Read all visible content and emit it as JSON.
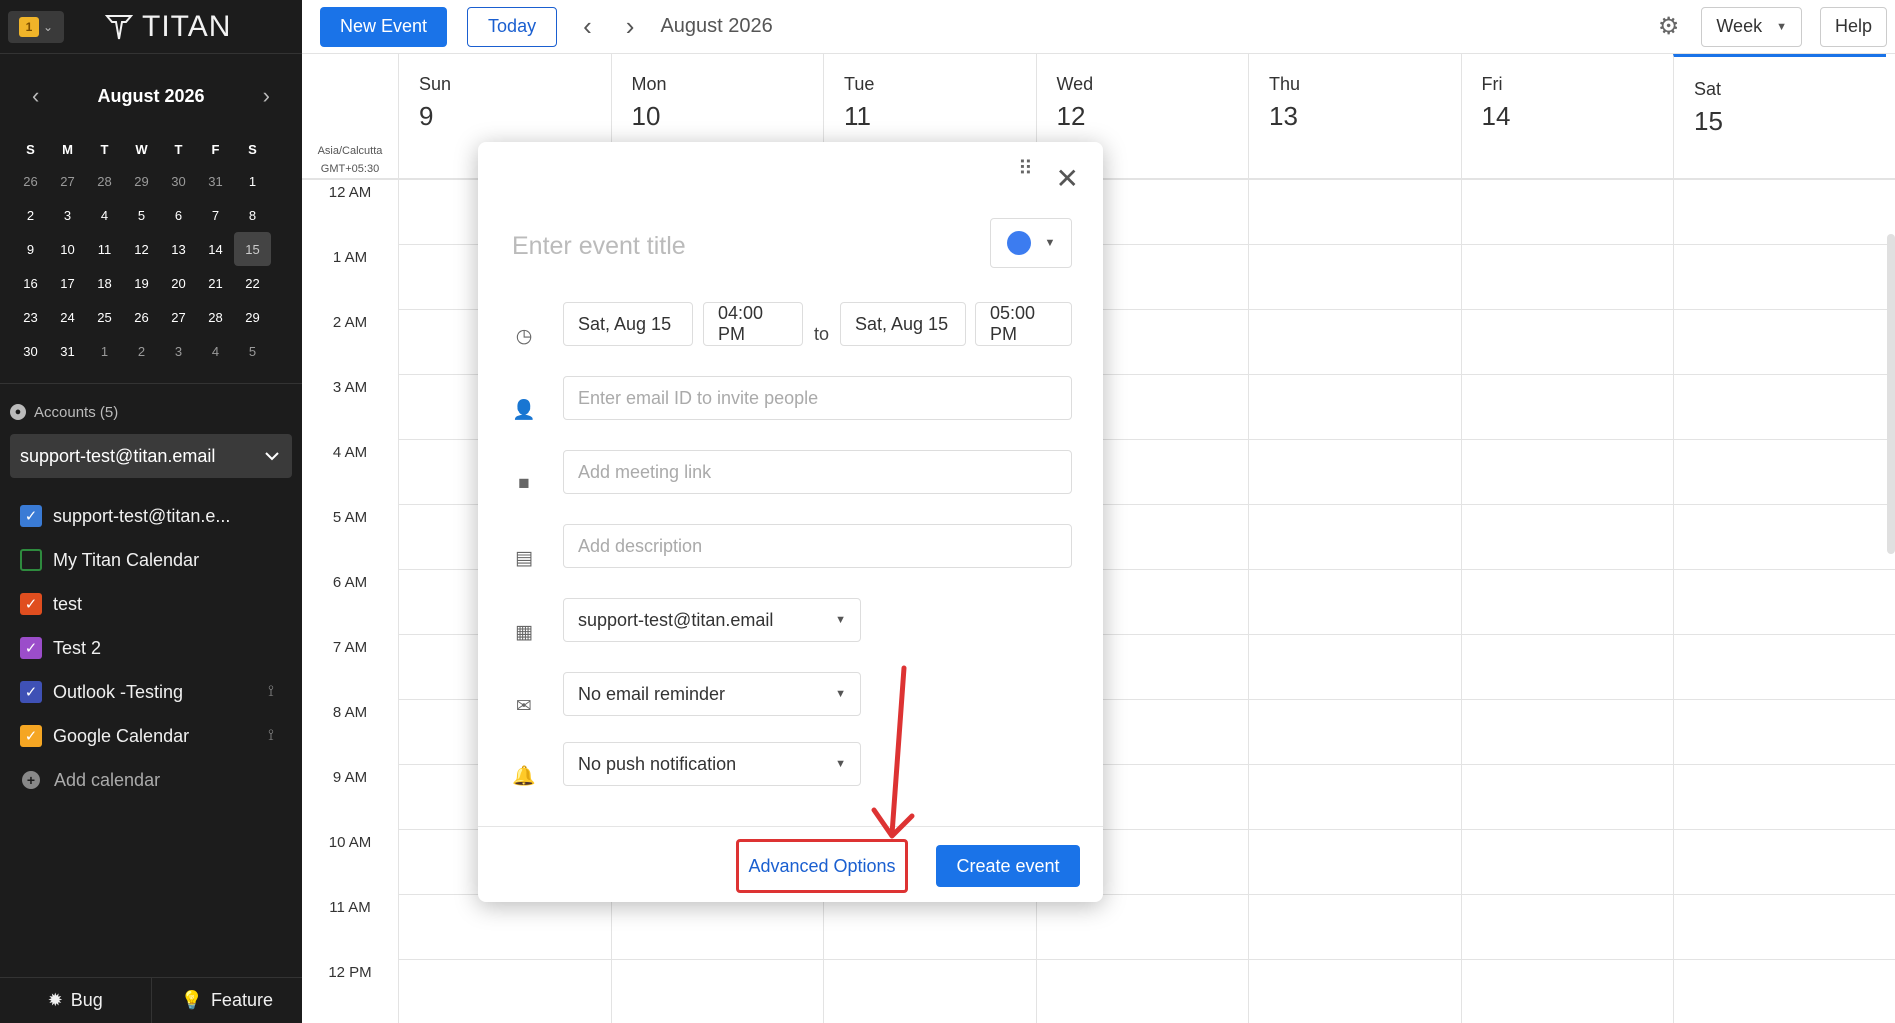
{
  "sidebar": {
    "app_badge": "1",
    "logo": "TITAN",
    "mini_cal": {
      "title": "August 2026",
      "dows": [
        "S",
        "M",
        "T",
        "W",
        "T",
        "F",
        "S"
      ],
      "days": [
        {
          "n": "26",
          "other": true
        },
        {
          "n": "27",
          "other": true
        },
        {
          "n": "28",
          "other": true
        },
        {
          "n": "29",
          "other": true
        },
        {
          "n": "30",
          "other": true
        },
        {
          "n": "31",
          "other": true
        },
        {
          "n": "1"
        },
        {
          "n": "2"
        },
        {
          "n": "3"
        },
        {
          "n": "4"
        },
        {
          "n": "5"
        },
        {
          "n": "6"
        },
        {
          "n": "7"
        },
        {
          "n": "8"
        },
        {
          "n": "9"
        },
        {
          "n": "10"
        },
        {
          "n": "11"
        },
        {
          "n": "12"
        },
        {
          "n": "13"
        },
        {
          "n": "14"
        },
        {
          "n": "15",
          "sel": true
        },
        {
          "n": "16"
        },
        {
          "n": "17"
        },
        {
          "n": "18"
        },
        {
          "n": "19"
        },
        {
          "n": "20"
        },
        {
          "n": "21"
        },
        {
          "n": "22"
        },
        {
          "n": "23"
        },
        {
          "n": "24"
        },
        {
          "n": "25"
        },
        {
          "n": "26"
        },
        {
          "n": "27"
        },
        {
          "n": "28"
        },
        {
          "n": "29"
        },
        {
          "n": "30"
        },
        {
          "n": "31"
        },
        {
          "n": "1",
          "other": true
        },
        {
          "n": "2",
          "other": true
        },
        {
          "n": "3",
          "other": true
        },
        {
          "n": "4",
          "other": true
        },
        {
          "n": "5",
          "other": true
        }
      ]
    },
    "accounts_label": "Accounts (5)",
    "account_selected": "support-test@titan.email",
    "calendars": [
      {
        "label": "support-test@titan.e...",
        "checked": true,
        "color": "#3a7bd5",
        "feed": false
      },
      {
        "label": "My Titan Calendar",
        "checked": false,
        "color": "#2e8b3e",
        "feed": false
      },
      {
        "label": "test",
        "checked": true,
        "color": "#e04e1f",
        "feed": false
      },
      {
        "label": "Test 2",
        "checked": true,
        "color": "#9b4dca",
        "feed": false
      },
      {
        "label": "Outlook -Testing",
        "checked": true,
        "color": "#3f51b5",
        "feed": true
      },
      {
        "label": "Google Calendar",
        "checked": true,
        "color": "#f5a623",
        "feed": true
      }
    ],
    "add_calendar": "Add calendar",
    "footer": {
      "bug": "Bug",
      "feature": "Feature"
    }
  },
  "topbar": {
    "new_event": "New Event",
    "today": "Today",
    "title": "August 2026",
    "view": "Week",
    "help": "Help"
  },
  "week": {
    "tz_line1": "Asia/Calcutta",
    "tz_line2": "GMT+05:30",
    "days": [
      {
        "name": "Sun",
        "num": "9"
      },
      {
        "name": "Mon",
        "num": "10"
      },
      {
        "name": "Tue",
        "num": "11"
      },
      {
        "name": "Wed",
        "num": "12"
      },
      {
        "name": "Thu",
        "num": "13"
      },
      {
        "name": "Fri",
        "num": "14"
      },
      {
        "name": "Sat",
        "num": "15",
        "today": true
      }
    ],
    "hours": [
      "12 AM",
      "1 AM",
      "2 AM",
      "3 AM",
      "4 AM",
      "5 AM",
      "6 AM",
      "7 AM",
      "8 AM",
      "9 AM",
      "10 AM",
      "11 AM",
      "12 PM"
    ]
  },
  "modal": {
    "title_placeholder": "Enter event title",
    "event_color": "#3c7cf0",
    "start_date": "Sat, Aug 15",
    "start_time": "04:00 PM",
    "to": "to",
    "end_date": "Sat, Aug 15",
    "end_time": "05:00 PM",
    "invite_placeholder": "Enter email ID to invite people",
    "meeting_placeholder": "Add meeting link",
    "description_placeholder": "Add description",
    "calendar_select": "support-test@titan.email",
    "email_reminder": "No email reminder",
    "push_notification": "No push notification",
    "advanced_options": "Advanced Options",
    "create_event": "Create event"
  }
}
